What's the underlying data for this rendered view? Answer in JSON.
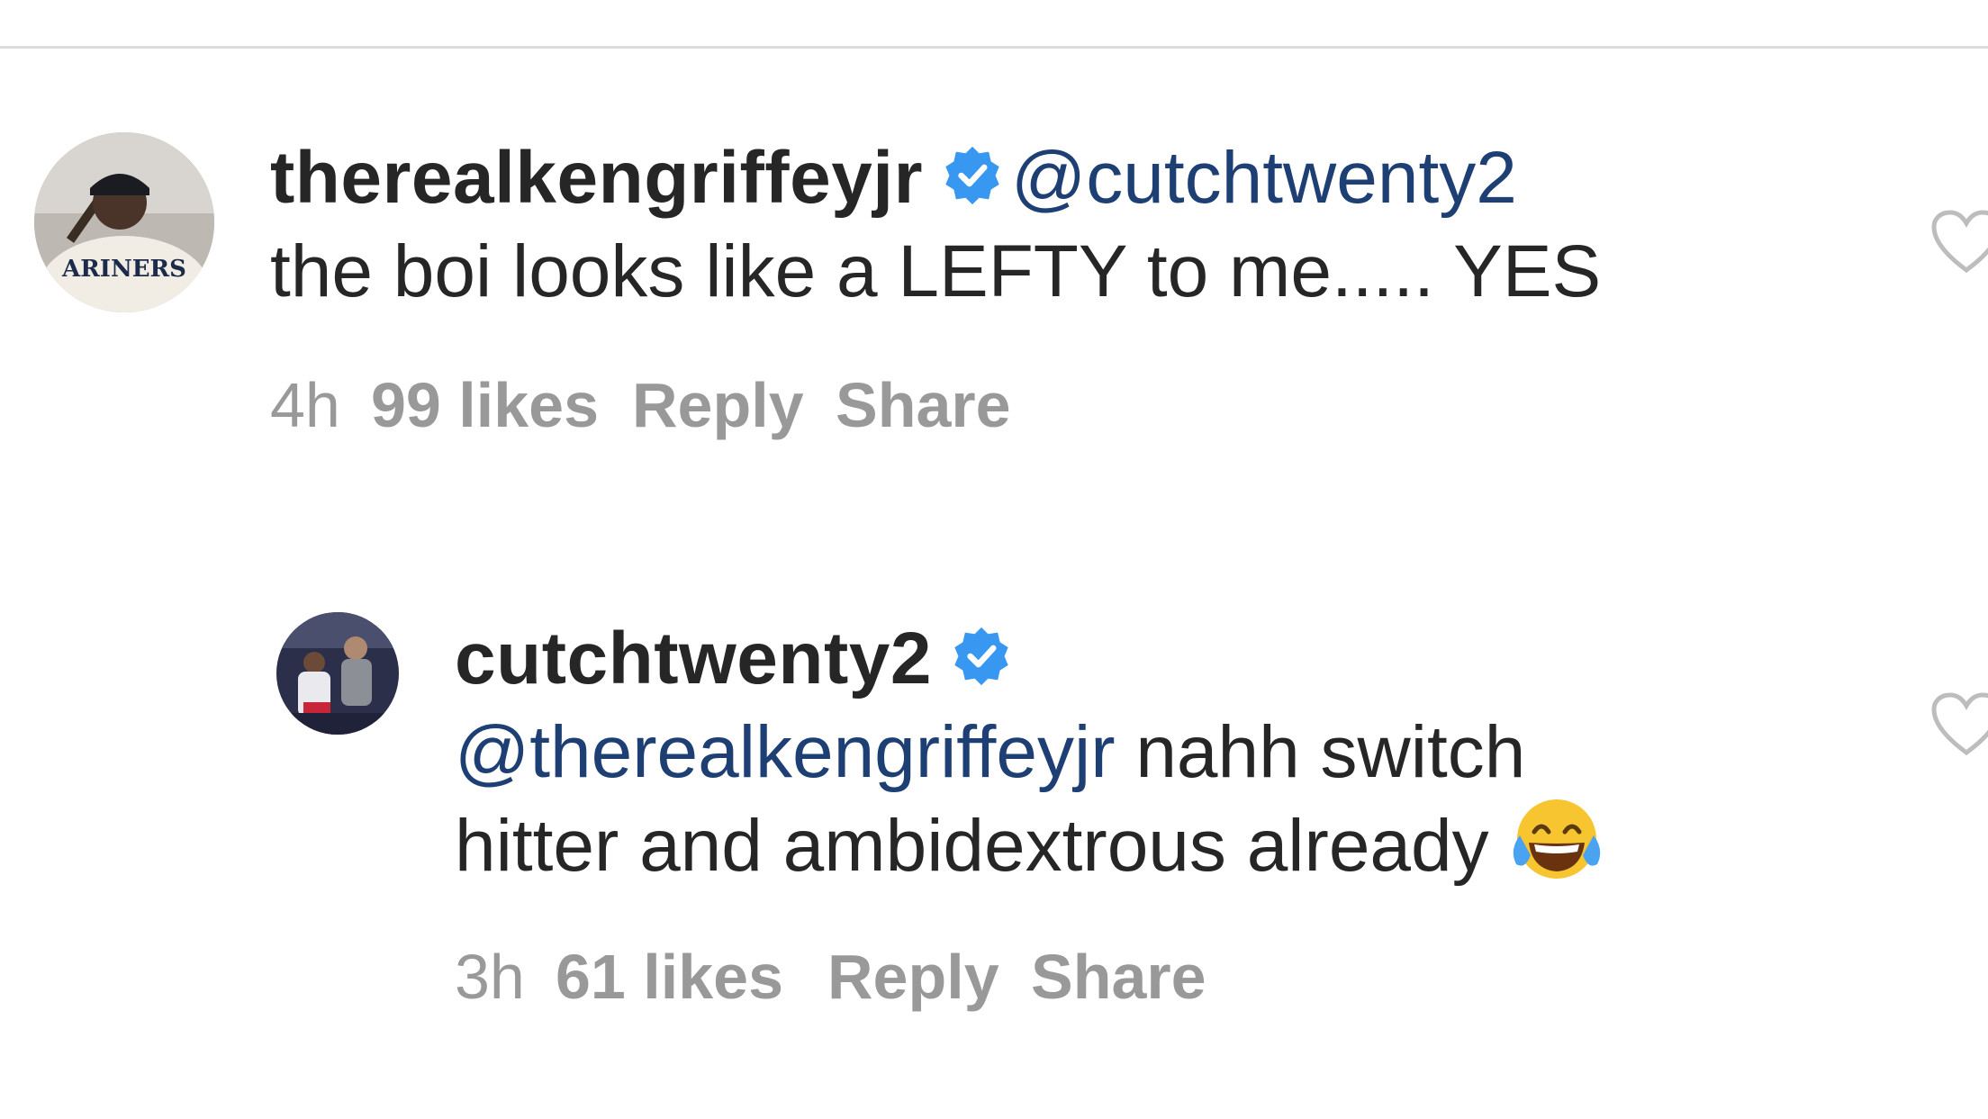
{
  "comments": [
    {
      "username": "therealkengriffeyjr",
      "verified": true,
      "mention": "@cutchtwenty2",
      "text": "the boi looks like a LEFTY to me..... YES",
      "avatar_text": "ARINERS",
      "time": "4h",
      "likes": "99 likes",
      "reply_label": "Reply",
      "share_label": "Share"
    },
    {
      "username": "cutchtwenty2",
      "verified": true,
      "mention": "@therealkengriffeyjr",
      "text_line1": "nahh switch",
      "text_line2": "hitter and ambidextrous already",
      "emoji": "face-with-tears-of-joy",
      "time": "3h",
      "likes": "61 likes",
      "reply_label": "Reply",
      "share_label": "Share"
    }
  ],
  "colors": {
    "text": "#262626",
    "mention": "#1e3f73",
    "meta": "#999999",
    "verified": "#3897f0",
    "divider": "#dcdcdc"
  }
}
